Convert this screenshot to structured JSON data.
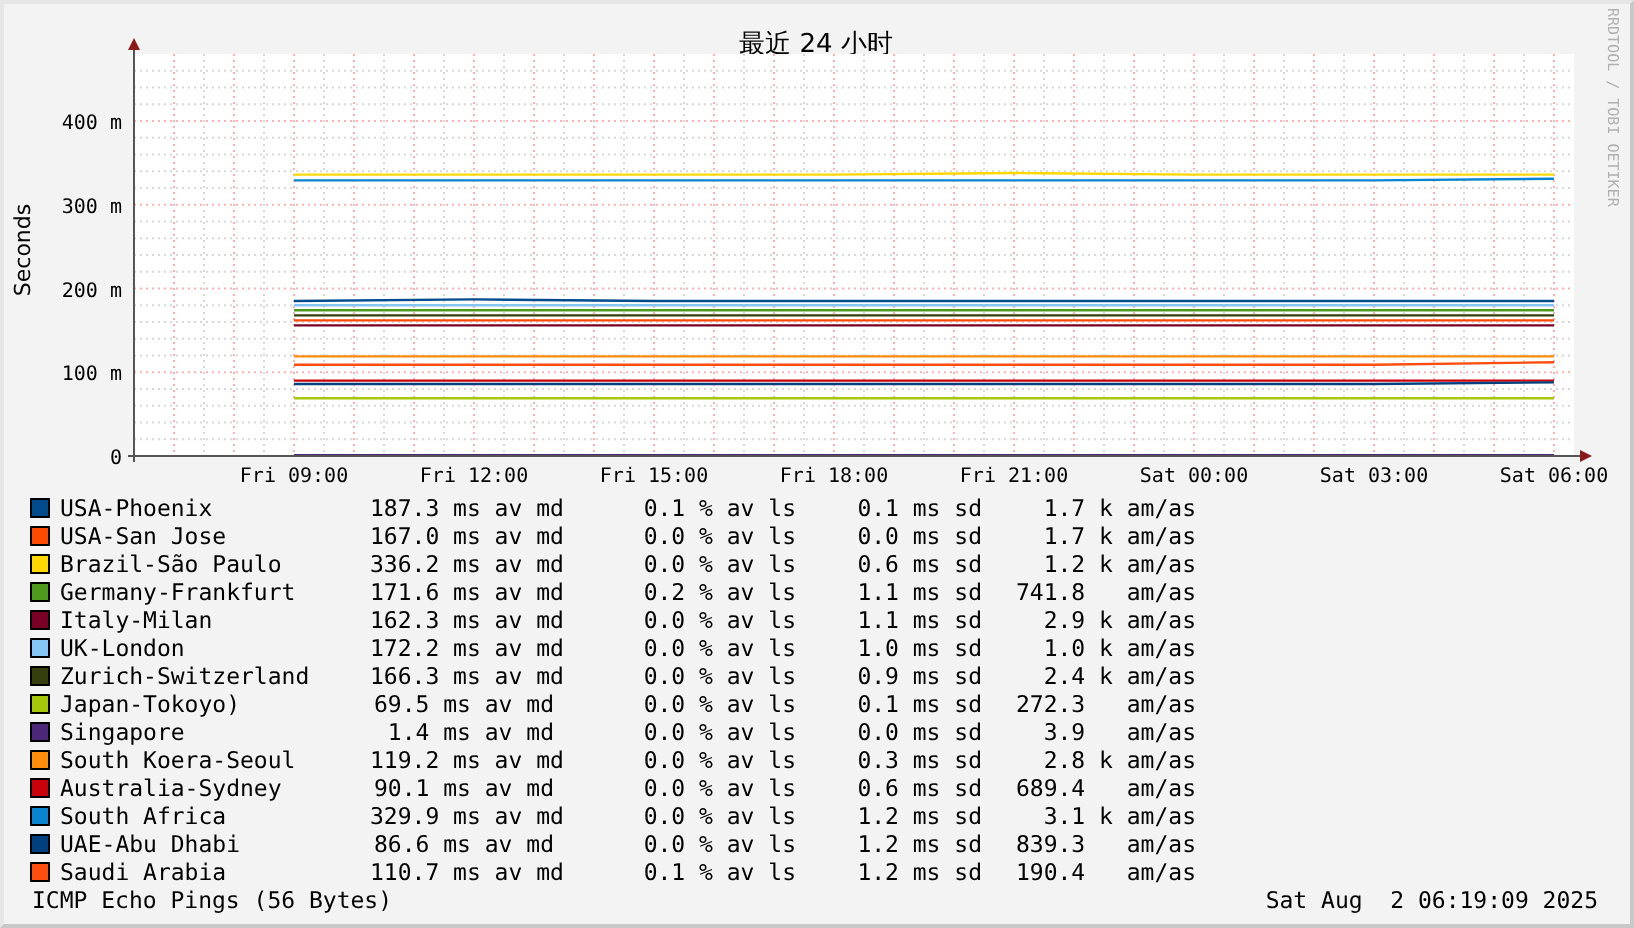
{
  "chart_data": {
    "type": "line",
    "title": "最近 24 小时",
    "ylabel": "Seconds",
    "categories": [
      "Fri 09:00",
      "Fri 12:00",
      "Fri 15:00",
      "Fri 18:00",
      "Fri 21:00",
      "Sat 00:00",
      "Sat 03:00",
      "Sat 06:00"
    ],
    "ylim": [
      0,
      480
    ],
    "grid": true,
    "yticks": [
      {
        "value": 0,
        "label": "0"
      },
      {
        "value": 100,
        "label": "100 m"
      },
      {
        "value": 200,
        "label": "200 m"
      },
      {
        "value": 300,
        "label": "300 m"
      },
      {
        "value": 400,
        "label": "400 m"
      }
    ],
    "series": [
      {
        "name": "USA-Phoenix",
        "color": "#004b8d",
        "values": [
          185,
          187,
          185,
          185,
          185,
          185,
          185,
          185
        ]
      },
      {
        "name": "USA-San Jose",
        "color": "#ff4a00",
        "values": [
          162,
          162,
          162,
          162,
          162,
          162,
          162,
          162
        ]
      },
      {
        "name": "Brazil-São Paulo",
        "color": "#ffd700",
        "values": [
          336,
          336,
          336,
          336,
          338,
          336,
          336,
          336
        ]
      },
      {
        "name": "Germany-Frankfurt",
        "color": "#4e9a1e",
        "values": [
          174,
          174,
          174,
          174,
          174,
          174,
          174,
          174
        ]
      },
      {
        "name": "Italy-Milan",
        "color": "#7a0026",
        "values": [
          156,
          156,
          156,
          156,
          156,
          156,
          156,
          156
        ]
      },
      {
        "name": "UK-London",
        "color": "#86c6f5",
        "values": [
          180,
          180,
          180,
          180,
          180,
          180,
          180,
          180
        ]
      },
      {
        "name": "Zurich-Switzerland",
        "color": "#343f0c",
        "values": [
          168,
          168,
          168,
          168,
          168,
          168,
          168,
          168
        ]
      },
      {
        "name": "Japan-Tokoyo)",
        "color": "#a6c80a",
        "values": [
          69,
          69,
          69,
          69,
          69,
          69,
          69,
          69
        ]
      },
      {
        "name": "Singapore",
        "color": "#4c2677",
        "values": [
          1,
          1,
          1,
          1,
          1,
          1,
          1,
          1
        ]
      },
      {
        "name": "South Koera-Seoul",
        "color": "#ff8c0a",
        "values": [
          119,
          119,
          119,
          119,
          119,
          119,
          119,
          119
        ]
      },
      {
        "name": "Australia-Sydney",
        "color": "#c8000a",
        "values": [
          90,
          90,
          90,
          90,
          90,
          90,
          90,
          90
        ]
      },
      {
        "name": "South Africa",
        "color": "#0a84d0",
        "values": [
          329,
          329,
          329,
          329,
          329,
          329,
          329,
          331
        ]
      },
      {
        "name": "UAE-Abu Dhabi",
        "color": "#00407e",
        "values": [
          86,
          86,
          86,
          86,
          86,
          86,
          86,
          88
        ]
      },
      {
        "name": "Saudi Arabia",
        "color": "#ff4d10",
        "values": [
          109,
          109,
          109,
          109,
          109,
          109,
          109,
          112
        ]
      }
    ]
  },
  "credit": "RRDTOOL / TOBI OETIKER",
  "legend": [
    {
      "median": "187.3 ms av md",
      "loss": "0.1 % av ls",
      "sd": "0.1 ms sd",
      "amas": "1.7 k am/as"
    },
    {
      "median": "167.0 ms av md",
      "loss": "0.0 % av ls",
      "sd": "0.0 ms sd",
      "amas": "1.7 k am/as"
    },
    {
      "median": "336.2 ms av md",
      "loss": "0.0 % av ls",
      "sd": "0.6 ms sd",
      "amas": "1.2 k am/as"
    },
    {
      "median": "171.6 ms av md",
      "loss": "0.2 % av ls",
      "sd": "1.1 ms sd",
      "amas": "741.8   am/as"
    },
    {
      "median": "162.3 ms av md",
      "loss": "0.0 % av ls",
      "sd": "1.1 ms sd",
      "amas": "2.9 k am/as"
    },
    {
      "median": "172.2 ms av md",
      "loss": "0.0 % av ls",
      "sd": "1.0 ms sd",
      "amas": "1.0 k am/as"
    },
    {
      "median": "166.3 ms av md",
      "loss": "0.0 % av ls",
      "sd": "0.9 ms sd",
      "amas": "2.4 k am/as"
    },
    {
      "median": "69.5 ms av md",
      "loss": "0.0 % av ls",
      "sd": "0.1 ms sd",
      "amas": "272.3   am/as"
    },
    {
      "median": "1.4 ms av md",
      "loss": "0.0 % av ls",
      "sd": "0.0 ms sd",
      "amas": "3.9   am/as"
    },
    {
      "median": "119.2 ms av md",
      "loss": "0.0 % av ls",
      "sd": "0.3 ms sd",
      "amas": "2.8 k am/as"
    },
    {
      "median": "90.1 ms av md",
      "loss": "0.0 % av ls",
      "sd": "0.6 ms sd",
      "amas": "689.4   am/as"
    },
    {
      "median": "329.9 ms av md",
      "loss": "0.0 % av ls",
      "sd": "1.2 ms sd",
      "amas": "3.1 k am/as"
    },
    {
      "median": "86.6 ms av md",
      "loss": "0.0 % av ls",
      "sd": "1.2 ms sd",
      "amas": "839.3   am/as"
    },
    {
      "median": "110.7 ms av md",
      "loss": "0.1 % av ls",
      "sd": "1.2 ms sd",
      "amas": "190.4   am/as"
    }
  ],
  "footer": {
    "probe": "ICMP Echo Pings (56 Bytes)",
    "timestamp": "Sat Aug  2 06:19:09 2025"
  }
}
